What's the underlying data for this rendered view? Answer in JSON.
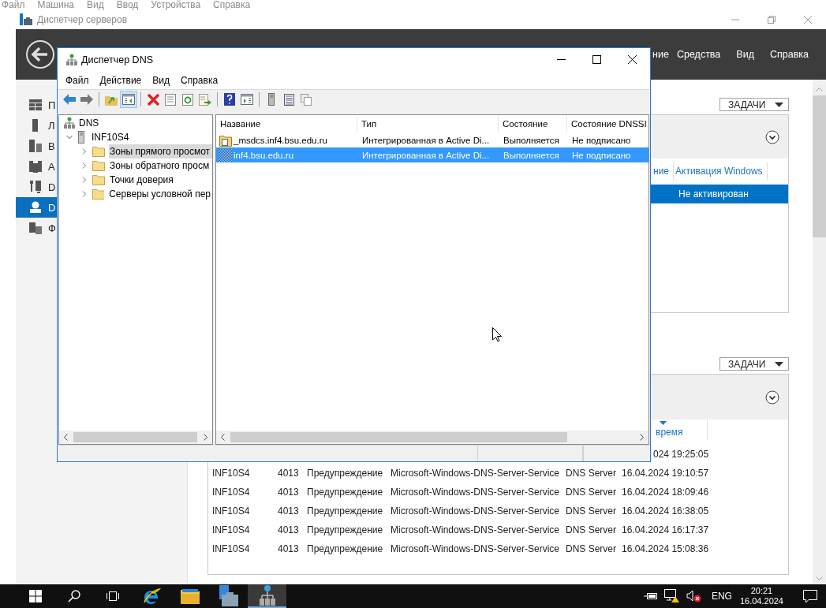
{
  "vm_menu": [
    "Файл",
    "Машина",
    "Вид",
    "Ввод",
    "Устройства",
    "Справка"
  ],
  "server_manager": {
    "title": "Диспетчер серверов",
    "header_menu": [
      "ние",
      "Средства",
      "Вид",
      "Справка"
    ],
    "sidebar": [
      {
        "label": "П",
        "selected": false
      },
      {
        "label": "Л",
        "selected": false
      },
      {
        "label": "В",
        "selected": false
      },
      {
        "label": "A",
        "selected": false
      },
      {
        "label": "D",
        "selected": false
      },
      {
        "label": "D",
        "selected": true
      },
      {
        "label": "Ф",
        "selected": false
      }
    ],
    "activation_tile": {
      "tasks_button": "ЗАДАЧИ",
      "columns": [
        "ние",
        "Активация Windows"
      ],
      "rows": [
        {
          "activation": "Не активирован",
          "selected": true
        }
      ]
    },
    "events_tile": {
      "tasks_button": "ЗАДАЧИ",
      "columns": [
        {
          "label": "время",
          "sorted": true
        }
      ],
      "rows": [
        {
          "kind": "cut",
          "time": "024 19:25:05"
        },
        {
          "kind": "full",
          "server": "INF10S4",
          "id": "4013",
          "level": "Предупреждение",
          "source": "Microsoft-Windows-DNS-Server-Service",
          "log": "DNS Server",
          "time": "16.04.2024 19:10:57"
        },
        {
          "kind": "full",
          "server": "INF10S4",
          "id": "4013",
          "level": "Предупреждение",
          "source": "Microsoft-Windows-DNS-Server-Service",
          "log": "DNS Server",
          "time": "16.04.2024 18:09:46"
        },
        {
          "kind": "full",
          "server": "INF10S4",
          "id": "4013",
          "level": "Предупреждение",
          "source": "Microsoft-Windows-DNS-Server-Service",
          "log": "DNS Server",
          "time": "16.04.2024 16:38:05"
        },
        {
          "kind": "full",
          "server": "INF10S4",
          "id": "4013",
          "level": "Предупреждение",
          "source": "Microsoft-Windows-DNS-Server-Service",
          "log": "DNS Server",
          "time": "16.04.2024 16:17:37"
        },
        {
          "kind": "full",
          "server": "INF10S4",
          "id": "4013",
          "level": "Предупреждение",
          "source": "Microsoft-Windows-DNS-Server-Service",
          "log": "DNS Server",
          "time": "16.04.2024 15:08:36"
        }
      ]
    }
  },
  "dns_window": {
    "title": "Диспетчер DNS",
    "menu": [
      "Файл",
      "Действие",
      "Вид",
      "Справка"
    ],
    "toolbar": [
      [
        {
          "kind": "back",
          "pressed": false
        },
        {
          "kind": "forward",
          "pressed": false
        }
      ],
      [
        {
          "kind": "up",
          "pressed": false
        },
        {
          "kind": "tree",
          "pressed": true
        }
      ],
      [
        {
          "kind": "delete",
          "pressed": false
        },
        {
          "kind": "properties",
          "pressed": false
        },
        {
          "kind": "refresh",
          "pressed": false
        },
        {
          "kind": "export",
          "pressed": false
        }
      ],
      [
        {
          "kind": "help",
          "pressed": false
        },
        {
          "kind": "console",
          "pressed": false
        }
      ],
      [
        {
          "kind": "server",
          "pressed": false
        },
        {
          "kind": "list",
          "pressed": false
        },
        {
          "kind": "copy",
          "pressed": false
        }
      ]
    ],
    "tree": {
      "label": "DNS",
      "children": [
        {
          "label": "INF10S4",
          "expanded": true,
          "selected": false,
          "children": [
            {
              "label": "Зоны прямого просмот",
              "expanded": false,
              "selected": true
            },
            {
              "label": "Зоны обратного просм",
              "expanded": false,
              "selected": false
            },
            {
              "label": "Точки доверия",
              "expanded": false,
              "selected": false
            },
            {
              "label": "Серверы условной пер",
              "expanded": false,
              "selected": false
            }
          ]
        }
      ]
    },
    "list": {
      "columns": [
        "Название",
        "Тип",
        "Состояние",
        "Состояние DNSSI"
      ],
      "rows": [
        {
          "kind": "delegation",
          "name": "_msdcs.inf4.bsu.edu.ru",
          "type": "Интегрированная в Active Di...",
          "status": "Выполняется",
          "dnssec": "Не подписано",
          "selected": false
        },
        {
          "kind": "zone",
          "name": "inf4.bsu.edu.ru",
          "type": "Интегрированная в Active Di...",
          "status": "Выполняется",
          "dnssec": "Не подписано",
          "selected": true
        }
      ]
    }
  },
  "taskbar": {
    "apps": [
      {
        "kind": "browser",
        "active": false
      },
      {
        "kind": "explorer",
        "active": false
      },
      {
        "kind": "server-manager",
        "active": false
      },
      {
        "kind": "dns",
        "active": true
      }
    ],
    "language": "ENG",
    "time": "20:21",
    "date": "16.04.2024"
  }
}
